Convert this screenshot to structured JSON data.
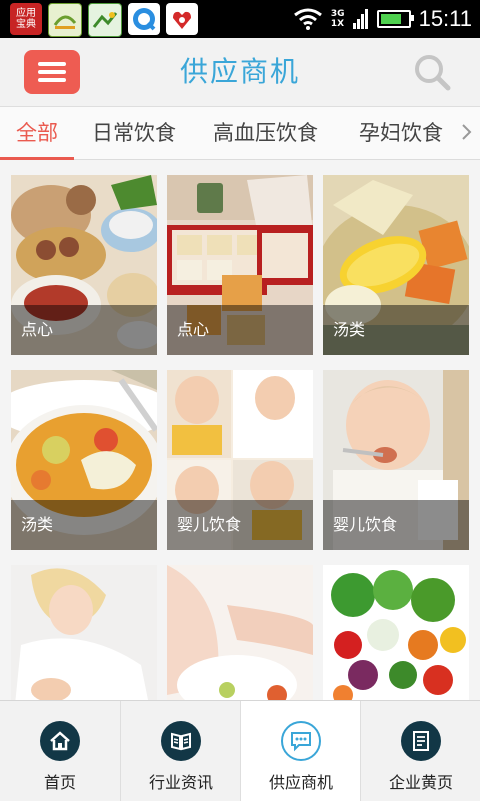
{
  "status_bar": {
    "app_icons": [
      {
        "name": "app-baodian-icon",
        "label": "应用\n宝典"
      },
      {
        "name": "app-green-icon"
      },
      {
        "name": "app-farm-icon"
      },
      {
        "name": "app-browser-icon"
      },
      {
        "name": "app-red-icon"
      }
    ],
    "network_label": "3G\n1X",
    "battery_level": 0.8,
    "time": "15:11"
  },
  "header": {
    "title": "供应商机",
    "menu_icon": "menu-icon",
    "search_icon": "search-icon"
  },
  "tabs": {
    "items": [
      "全部",
      "日常饮食",
      "高血压饮食",
      "孕妇饮食"
    ],
    "active_index": 0,
    "more_icon": "chevron-right-icon",
    "accent_color": "#ea5a4f"
  },
  "grid": {
    "items": [
      {
        "caption": "点心"
      },
      {
        "caption": "点心"
      },
      {
        "caption": "汤类"
      },
      {
        "caption": "汤类"
      },
      {
        "caption": "婴儿饮食"
      },
      {
        "caption": "婴儿饮食"
      },
      {
        "caption": ""
      },
      {
        "caption": ""
      },
      {
        "caption": ""
      }
    ]
  },
  "bottom_nav": {
    "items": [
      {
        "label": "首页",
        "icon": "home-icon"
      },
      {
        "label": "行业资讯",
        "icon": "book-icon"
      },
      {
        "label": "供应商机",
        "icon": "chat-icon"
      },
      {
        "label": "企业黄页",
        "icon": "document-icon"
      }
    ],
    "active_index": 2
  },
  "colors": {
    "title": "#3aa6d8",
    "menu_button": "#ee5c52",
    "nav_icon": "#123746"
  }
}
